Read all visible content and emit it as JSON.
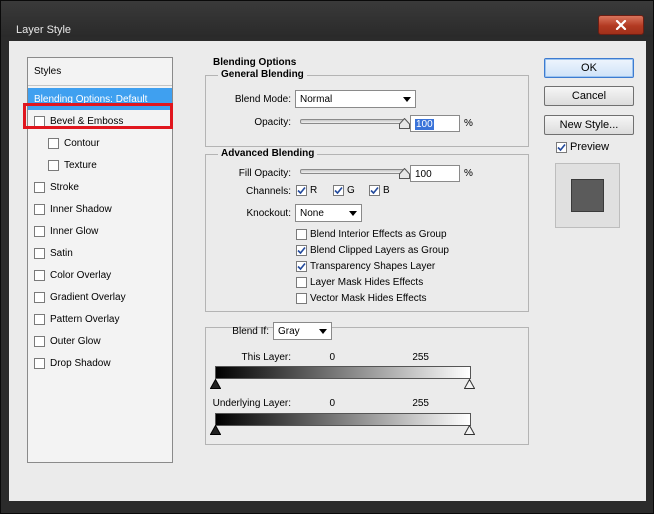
{
  "window": {
    "title": "Layer Style"
  },
  "styles_panel": {
    "header": "Styles",
    "items": [
      {
        "label": "Blending Options: Default",
        "selected": true,
        "checkbox": false
      },
      {
        "label": "Bevel & Emboss",
        "checkbox": true,
        "checked": false
      },
      {
        "label": "Contour",
        "checkbox": true,
        "checked": false,
        "indent": true
      },
      {
        "label": "Texture",
        "checkbox": true,
        "checked": false,
        "indent": true
      },
      {
        "label": "Stroke",
        "checkbox": true,
        "checked": false
      },
      {
        "label": "Inner Shadow",
        "checkbox": true,
        "checked": false
      },
      {
        "label": "Inner Glow",
        "checkbox": true,
        "checked": false
      },
      {
        "label": "Satin",
        "checkbox": true,
        "checked": false
      },
      {
        "label": "Color Overlay",
        "checkbox": true,
        "checked": false
      },
      {
        "label": "Gradient Overlay",
        "checkbox": true,
        "checked": false
      },
      {
        "label": "Pattern Overlay",
        "checkbox": true,
        "checked": false
      },
      {
        "label": "Outer Glow",
        "checkbox": true,
        "checked": false
      },
      {
        "label": "Drop Shadow",
        "checkbox": true,
        "checked": false
      }
    ]
  },
  "blending": {
    "section_title": "Blending Options",
    "general": {
      "legend": "General Blending",
      "blend_mode_label": "Blend Mode:",
      "blend_mode_value": "Normal",
      "opacity_label": "Opacity:",
      "opacity_value": "100",
      "opacity_level": 1.0,
      "pct": "%"
    },
    "advanced": {
      "legend": "Advanced Blending",
      "fill_opacity_label": "Fill Opacity:",
      "fill_opacity_value": "100",
      "fill_opacity_level": 1.0,
      "pct": "%",
      "channels_label": "Channels:",
      "channels": [
        {
          "label": "R",
          "checked": true
        },
        {
          "label": "G",
          "checked": true
        },
        {
          "label": "B",
          "checked": true
        }
      ],
      "knockout_label": "Knockout:",
      "knockout_value": "None",
      "options": [
        {
          "label": "Blend Interior Effects as Group",
          "checked": false
        },
        {
          "label": "Blend Clipped Layers as Group",
          "checked": true
        },
        {
          "label": "Transparency Shapes Layer",
          "checked": true
        },
        {
          "label": "Layer Mask Hides Effects",
          "checked": false
        },
        {
          "label": "Vector Mask Hides Effects",
          "checked": false
        }
      ]
    },
    "blend_if": {
      "label": "Blend If:",
      "value": "Gray",
      "this_layer_label": "This Layer:",
      "this_layer_min": "0",
      "this_layer_max": "255",
      "underlying_label": "Underlying Layer:",
      "underlying_min": "0",
      "underlying_max": "255"
    }
  },
  "buttons": {
    "ok": "OK",
    "cancel": "Cancel",
    "new_style": "New Style...",
    "preview_label": "Preview",
    "preview_checked": true
  },
  "colors": {
    "selection": "#3fa0f0",
    "highlight": "#e0161e",
    "close": "#b23a22"
  }
}
